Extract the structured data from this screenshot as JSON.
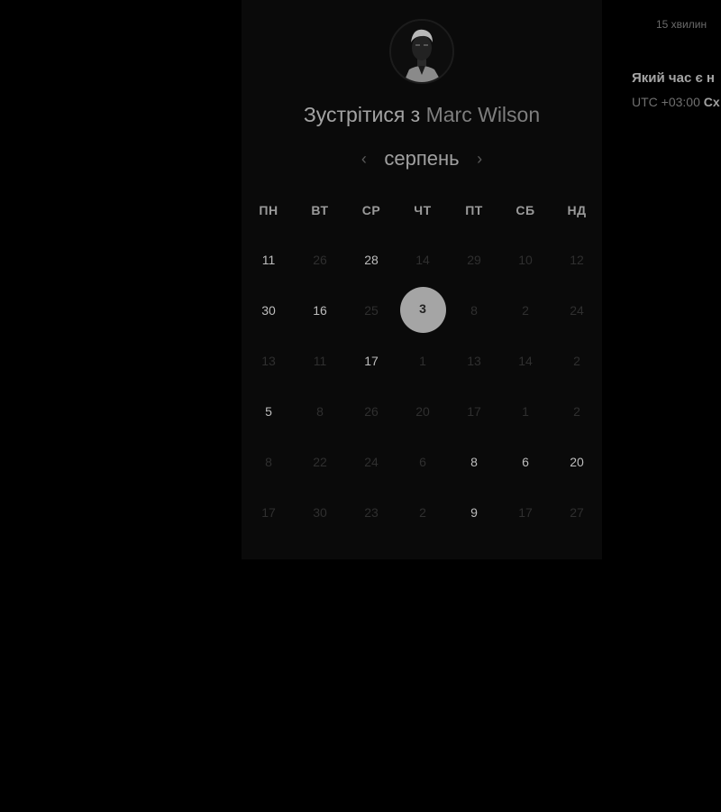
{
  "header": {
    "avatar_icon": "person-photo-icon",
    "title_prefix": "Зустрітися з",
    "host_name": "Marc Wilson"
  },
  "meeting": {
    "duration": "15 хвилин"
  },
  "calendar": {
    "month": "серпень",
    "prev_icon": "chevron-left-icon",
    "next_icon": "chevron-right-icon",
    "prev_glyph": "‹",
    "next_glyph": "›",
    "weekdays": [
      "ПН",
      "ВТ",
      "СР",
      "ЧТ",
      "ПТ",
      "СБ",
      "НД"
    ],
    "weeks": [
      [
        {
          "d": "11",
          "s": "enabled"
        },
        {
          "d": "26",
          "s": "disabled"
        },
        {
          "d": "28",
          "s": "enabled"
        },
        {
          "d": "14",
          "s": "disabled"
        },
        {
          "d": "29",
          "s": "disabled"
        },
        {
          "d": "10",
          "s": "disabled"
        },
        {
          "d": "12",
          "s": "disabled"
        }
      ],
      [
        {
          "d": "30",
          "s": "enabled"
        },
        {
          "d": "16",
          "s": "enabled"
        },
        {
          "d": "25",
          "s": "disabled"
        },
        {
          "d": "3",
          "s": "selected"
        },
        {
          "d": "8",
          "s": "disabled"
        },
        {
          "d": "2",
          "s": "disabled"
        },
        {
          "d": "24",
          "s": "disabled"
        }
      ],
      [
        {
          "d": "13",
          "s": "disabled"
        },
        {
          "d": "11",
          "s": "disabled"
        },
        {
          "d": "17",
          "s": "enabled"
        },
        {
          "d": "1",
          "s": "disabled"
        },
        {
          "d": "13",
          "s": "disabled"
        },
        {
          "d": "14",
          "s": "disabled"
        },
        {
          "d": "2",
          "s": "disabled"
        }
      ],
      [
        {
          "d": "5",
          "s": "enabled"
        },
        {
          "d": "8",
          "s": "disabled"
        },
        {
          "d": "26",
          "s": "disabled"
        },
        {
          "d": "20",
          "s": "disabled"
        },
        {
          "d": "17",
          "s": "disabled"
        },
        {
          "d": "1",
          "s": "disabled"
        },
        {
          "d": "2",
          "s": "disabled"
        }
      ],
      [
        {
          "d": "8",
          "s": "disabled"
        },
        {
          "d": "22",
          "s": "disabled"
        },
        {
          "d": "24",
          "s": "disabled"
        },
        {
          "d": "6",
          "s": "disabled"
        },
        {
          "d": "8",
          "s": "enabled"
        },
        {
          "d": "6",
          "s": "enabled"
        },
        {
          "d": "20",
          "s": "enabled"
        }
      ],
      [
        {
          "d": "17",
          "s": "disabled"
        },
        {
          "d": "30",
          "s": "disabled"
        },
        {
          "d": "23",
          "s": "disabled"
        },
        {
          "d": "2",
          "s": "disabled"
        },
        {
          "d": "9",
          "s": "enabled"
        },
        {
          "d": "17",
          "s": "disabled"
        },
        {
          "d": "27",
          "s": "disabled"
        }
      ]
    ]
  },
  "timezone": {
    "question": "Який час є н",
    "offset": "UTC +03:00",
    "name": "Сх"
  },
  "colors": {
    "background": "#000000",
    "card": "#0a0a0a",
    "selected_day": "#a5a5a5"
  }
}
